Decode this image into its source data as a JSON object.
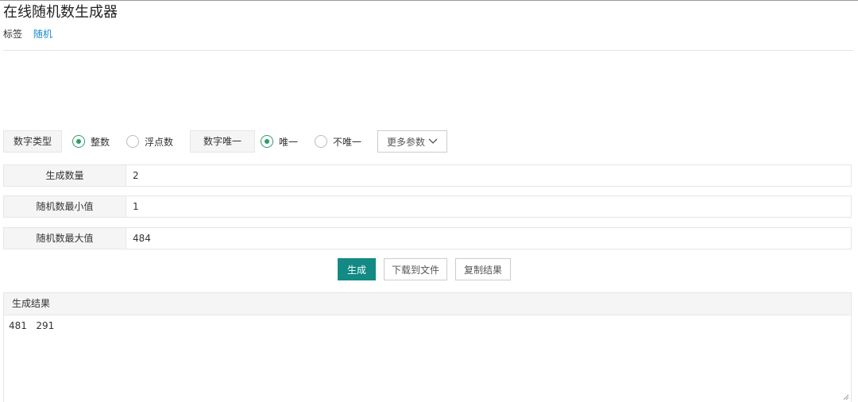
{
  "header": {
    "title": "在线随机数生成器",
    "tag_label": "标签",
    "tag_link": "随机"
  },
  "options": {
    "type_label": "数字类型",
    "type_choices": [
      "整数",
      "浮点数"
    ],
    "type_selected": "整数",
    "unique_label": "数字唯一",
    "unique_choices": [
      "唯一",
      "不唯一"
    ],
    "unique_selected": "唯一",
    "more_label": "更多参数"
  },
  "fields": {
    "count_label": "生成数量",
    "count_value": "2",
    "min_label": "随机数最小值",
    "min_value": "1",
    "max_label": "随机数最大值",
    "max_value": "484"
  },
  "actions": {
    "generate": "生成",
    "download": "下载到文件",
    "copy": "复制结果"
  },
  "result": {
    "heading": "生成结果",
    "text": "481   291"
  },
  "colors": {
    "accent": "#138a84",
    "radio_selected": "#2e9c6a",
    "link": "#1a8bc9"
  },
  "icons": {
    "more": "chevron-down-icon",
    "resize": "resize-grip-icon"
  }
}
